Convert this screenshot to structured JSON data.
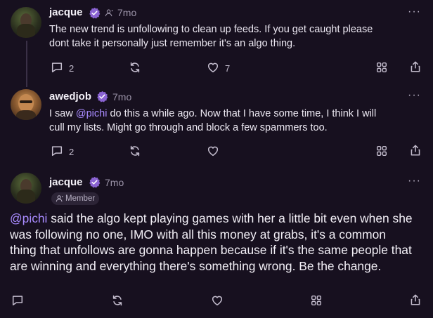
{
  "posts": [
    {
      "author": "jacque",
      "time": "7mo",
      "text": "The new trend is unfollowing to clean up feeds. If you get caught please dont take it personally just remember it's an algo thing.",
      "line1": "The new trend is unfollowing to clean up feeds. If you get caught please",
      "line2": "dont take it personally just remember it's an algo thing.",
      "replies": "2",
      "likes": "7"
    },
    {
      "author": "awedjob",
      "time": "7mo",
      "line1_pre": "I saw ",
      "line1_mention": "@pichi",
      "line1_post": " do this a while ago. Now that I have some time, I think I will",
      "line2": "cull my lists. Might go through and block a few spammers too.",
      "replies": "2"
    },
    {
      "author": "jacque",
      "time": "7mo",
      "role_badge": "Member",
      "line1_mention": "@pichi",
      "line1_post": " said the algo kept playing games with her a little bit even when she",
      "line2": "was following no one, IMO with all this money at grabs, it's a common",
      "line3": "thing that unfollows are gonna happen because if it's the same people that",
      "line4": "are winning and everything there's something wrong. Be the change."
    }
  ],
  "icons": {
    "reply": "chat-bubble-icon",
    "recast": "recast-arrows-icon",
    "like": "heart-icon",
    "grid": "grid-icon",
    "share": "share-icon",
    "more": "more-horizontal-icon",
    "verified": "verified-badge-icon",
    "member": "member-person-icon"
  },
  "colors": {
    "background": "#17101f",
    "accent": "#8a63d2",
    "mention": "#a98bff",
    "muted": "#9b93a8"
  }
}
